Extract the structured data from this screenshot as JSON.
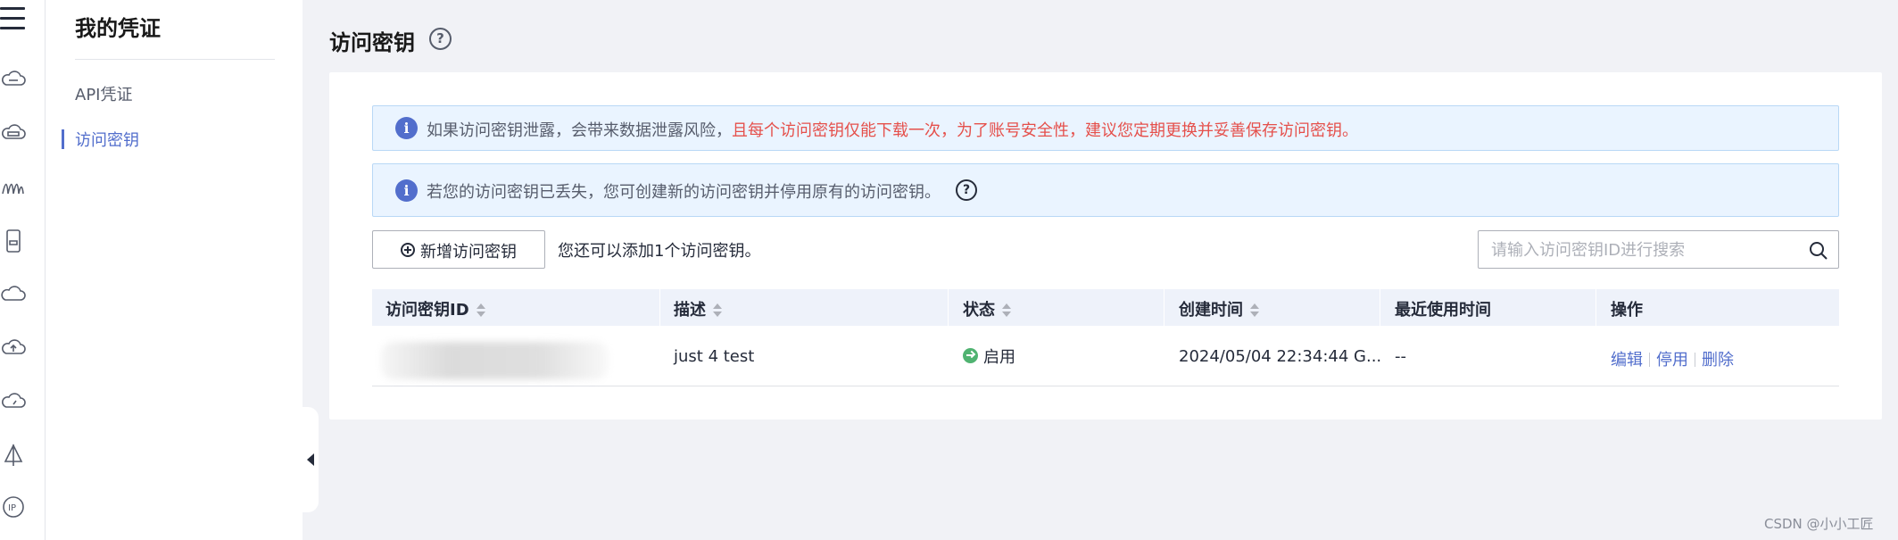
{
  "rail": {
    "icons": [
      "cloud-server-icon",
      "cloud-hdd-icon",
      "network-icon",
      "mobile-icon",
      "cloud-icon",
      "cloud-upload-icon",
      "cloud-speed-icon",
      "sail-icon",
      "ip-icon"
    ]
  },
  "subnav": {
    "title": "我的凭证",
    "items": [
      {
        "label": "API凭证",
        "active": false
      },
      {
        "label": "访问密钥",
        "active": true
      }
    ]
  },
  "page": {
    "title": "访问密钥"
  },
  "alerts": {
    "first_normal": "如果访问密钥泄露，会带来数据泄露风险，",
    "first_red": "且每个访问密钥仅能下载一次，为了账号安全性，建议您定期更换并妥善保存访问密钥。",
    "second": "若您的访问密钥已丢失，您可创建新的访问密钥并停用原有的访问密钥。"
  },
  "toolbar": {
    "add_label": "新增访问密钥",
    "quota_text": "您还可以添加1个访问密钥。",
    "search_placeholder": "请输入访问密钥ID进行搜索"
  },
  "table": {
    "columns": [
      "访问密钥ID",
      "描述",
      "状态",
      "创建时间",
      "最近使用时间",
      "操作"
    ],
    "rows": [
      {
        "id": "",
        "description": "just 4 test",
        "status": "启用",
        "created": "2024/05/04 22:34:44 G...",
        "last_used": "--",
        "actions": [
          "编辑",
          "停用",
          "删除"
        ]
      }
    ]
  },
  "watermark": "CSDN @小小工匠",
  "colors": {
    "accent": "#526ecc",
    "warning_red": "#e5504b",
    "success": "#50b371",
    "alert_bg": "#eaf4ff"
  }
}
